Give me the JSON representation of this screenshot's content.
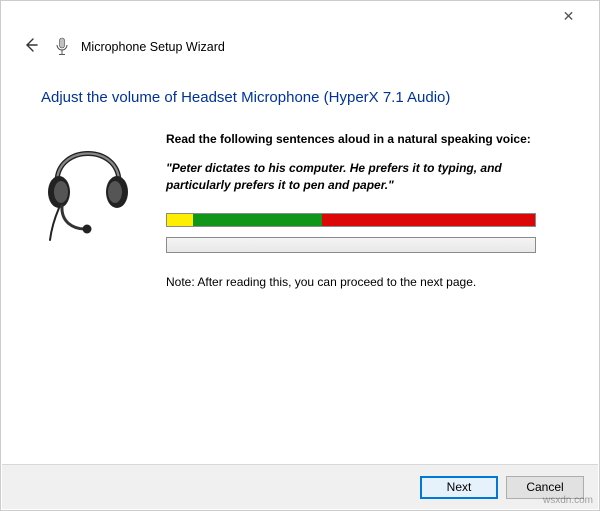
{
  "window": {
    "close_label": "✕"
  },
  "header": {
    "title": "Microphone Setup Wizard"
  },
  "page": {
    "heading": "Adjust the volume of Headset Microphone (HyperX 7.1 Audio)",
    "instruction": "Read the following sentences aloud in a natural speaking voice:",
    "quote": "\"Peter dictates to his computer. He prefers it to typing, and particularly prefers it to pen and paper.\"",
    "note": "Note: After reading this, you can proceed to the next page."
  },
  "meter": {
    "yellow_pct": 7,
    "green_pct": 35,
    "red_pct": 58,
    "white_pct": 0
  },
  "footer": {
    "next_label": "Next",
    "cancel_label": "Cancel"
  },
  "watermark": "wsxdn.com"
}
